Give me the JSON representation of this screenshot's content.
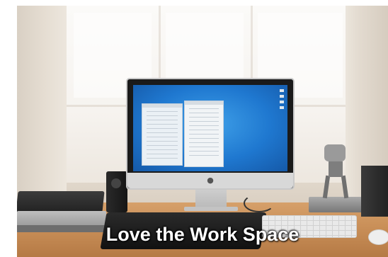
{
  "photo": {
    "caption": "Love the Work Space",
    "monitor_brand_icon": "apple-logo-icon",
    "colors": {
      "screen_blue": "#1f78d0",
      "desk_wood": "#c98f58",
      "caption_text": "#ffffff"
    }
  }
}
